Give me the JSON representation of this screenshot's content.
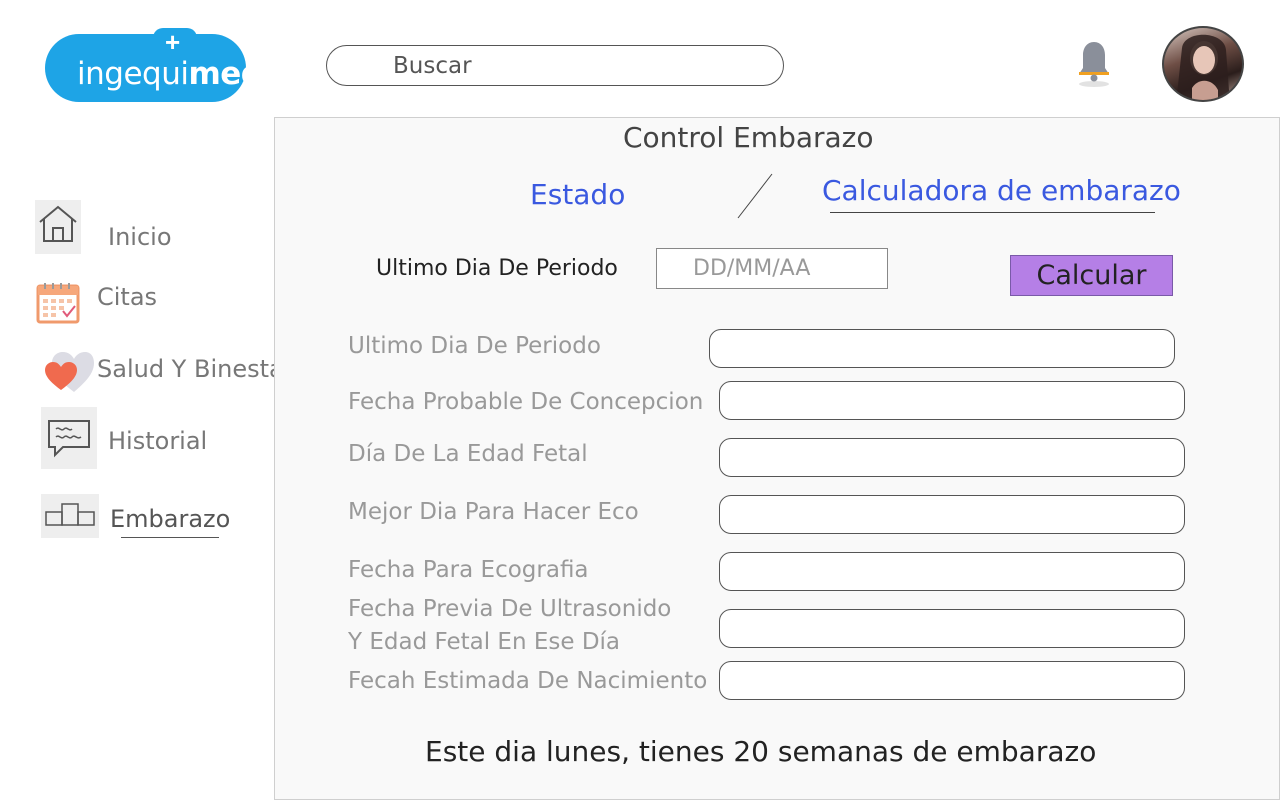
{
  "header": {
    "logo": {
      "text_light": "ingequi",
      "text_bold": "med"
    },
    "search": {
      "placeholder": "Buscar"
    }
  },
  "sidebar": {
    "items": [
      {
        "label": "Inicio",
        "icon": "home-icon"
      },
      {
        "label": "Citas",
        "icon": "calendar-icon"
      },
      {
        "label": "Salud Y Binestar",
        "icon": "heart-icon"
      },
      {
        "label": "Historial",
        "icon": "chat-icon"
      },
      {
        "label": "Embarazo",
        "icon": "podium-icon",
        "active": true
      }
    ]
  },
  "main": {
    "title": "Control Embarazo",
    "tabs": [
      {
        "label": "Estado"
      },
      {
        "label": "Calculadora de embarazo",
        "active": true
      }
    ],
    "last_period_label": "Ultimo Dia De Periodo",
    "date_placeholder": "DD/MM/AA",
    "calculate_label": "Calcular",
    "fields": [
      {
        "label": "Ultimo Dia De Periodo",
        "value": ""
      },
      {
        "label": "Fecha Probable De Concepcion",
        "value": ""
      },
      {
        "label": "Día De La Edad Fetal",
        "value": ""
      },
      {
        "label": "Mejor Dia Para Hacer Eco",
        "value": ""
      },
      {
        "label": "Fecha Para Ecografia",
        "value": ""
      },
      {
        "label_line1": "Fecha Previa De Ultrasonido",
        "label_line2": "Y Edad Fetal En Ese Día",
        "value": ""
      },
      {
        "label": "Fecah Estimada De Nacimiento",
        "value": ""
      }
    ],
    "summary": "Este dia lunes, tienes 20 semanas de embarazo"
  },
  "colors": {
    "brand": "#1ea4e6",
    "tab_link": "#3a59e0",
    "calculate_button": "#b57fe6"
  }
}
